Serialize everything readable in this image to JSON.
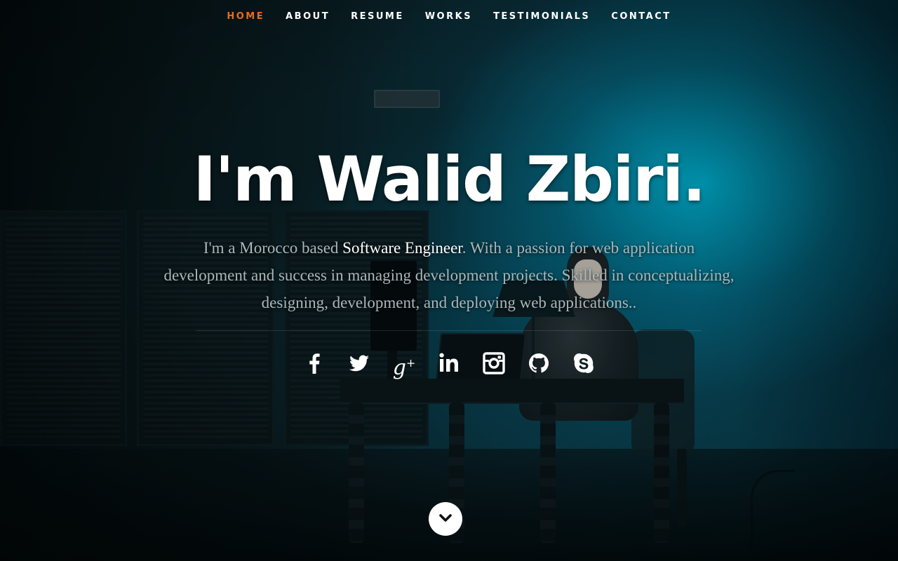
{
  "nav": {
    "items": [
      {
        "label": "HOME",
        "current": true
      },
      {
        "label": "ABOUT",
        "current": false
      },
      {
        "label": "RESUME",
        "current": false
      },
      {
        "label": "WORKS",
        "current": false
      },
      {
        "label": "TESTIMONIALS",
        "current": false
      },
      {
        "label": "CONTACT",
        "current": false
      }
    ]
  },
  "banner": {
    "heading": "I'm Walid Zbiri.",
    "intro_before": "I'm a Morocco based ",
    "intro_highlight": "Software Engineer",
    "intro_after": ". With a passion for web application development and success in managing development projects. Skilled in conceptualizing, designing, development, and deploying web applications.."
  },
  "social": [
    {
      "icon": "facebook-icon"
    },
    {
      "icon": "twitter-icon"
    },
    {
      "icon": "google-plus-icon"
    },
    {
      "icon": "linkedin-icon"
    },
    {
      "icon": "instagram-icon"
    },
    {
      "icon": "github-icon"
    },
    {
      "icon": "skype-icon"
    }
  ],
  "scroll_down": {
    "icon": "chevron-down-icon"
  },
  "colors": {
    "accent": "#e86b1e",
    "text": "#ffffff",
    "muted_text": "#a9b8bb",
    "background_teal": "#0a4a5c"
  }
}
